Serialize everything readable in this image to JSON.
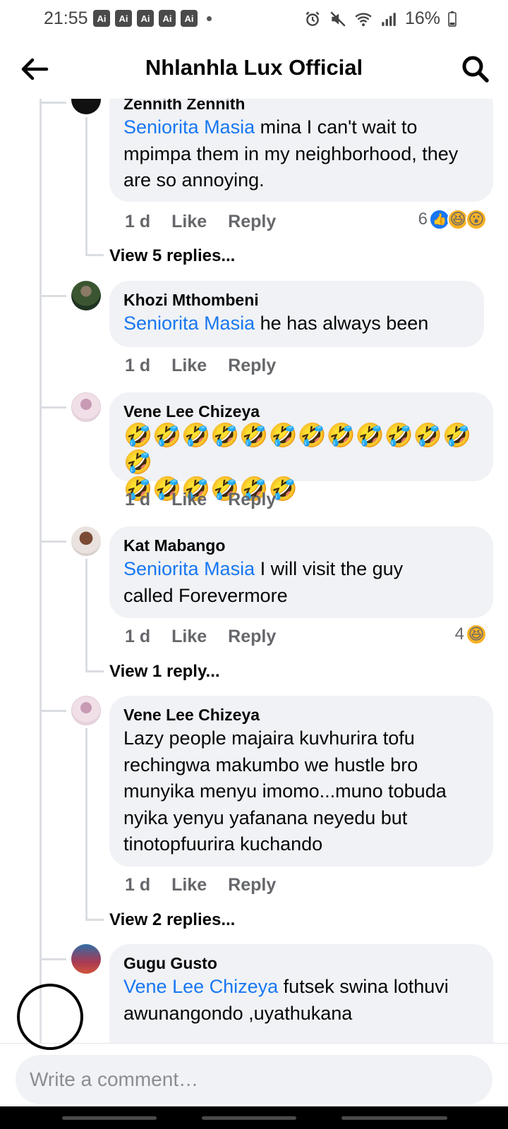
{
  "status_bar": {
    "time": "21:55",
    "ai_badges": [
      "Ai",
      "Ai",
      "Ai",
      "Ai",
      "Ai"
    ],
    "battery": "16%"
  },
  "header": {
    "title": "Nhlanhla Lux Official"
  },
  "comments": [
    {
      "author": "Zennith Zennith",
      "mention": "Seniorita Masia",
      "text": " mina I can't wait to mpimpa them in my neighborhood, they are so annoying.",
      "time": "1 d",
      "like": "Like",
      "reply": "Reply",
      "reaction_count": "6",
      "reactions": [
        "like-icon",
        "haha-icon",
        "wow-icon"
      ],
      "view_replies": "View 5 replies..."
    },
    {
      "author": "Khozi Mthombeni",
      "mention": "Seniorita Masia",
      "text": " he has always been",
      "time": "1 d",
      "like": "Like",
      "reply": "Reply"
    },
    {
      "author": "Vene Lee Chizeya",
      "emoji_lines": [
        "🤣🤣🤣🤣🤣🤣🤣🤣🤣🤣🤣🤣🤣",
        "🤣🤣🤣🤣🤣🤣"
      ],
      "time": "1 d",
      "like": "Like",
      "reply": "Reply"
    },
    {
      "author": "Kat Mabango",
      "mention": "Seniorita Masia",
      "text": " I will visit the guy called Forevermore",
      "time": "1 d",
      "like": "Like",
      "reply": "Reply",
      "reaction_count": "4",
      "reactions": [
        "haha-icon"
      ],
      "view_replies": "View 1 reply..."
    },
    {
      "author": "Vene Lee Chizeya",
      "text": "Lazy people majaira kuvhurira tofu rechingwa makumbo we hustle bro munyika menyu imomo...muno tobuda nyika yenyu yafanana neyedu but tinotopfuurira kuchando",
      "time": "1 d",
      "like": "Like",
      "reply": "Reply",
      "view_replies": "View 2 replies..."
    },
    {
      "author": "Gugu Gusto",
      "mention": "Vene Lee Chizeya",
      "text": " futsek swina lothuvi awunangondo ,uyathukana"
    }
  ],
  "composer": {
    "placeholder": "Write a comment…"
  },
  "colors": {
    "link": "#1877f2",
    "bubble": "#f0f2f5",
    "secondary_text": "#65676b"
  }
}
